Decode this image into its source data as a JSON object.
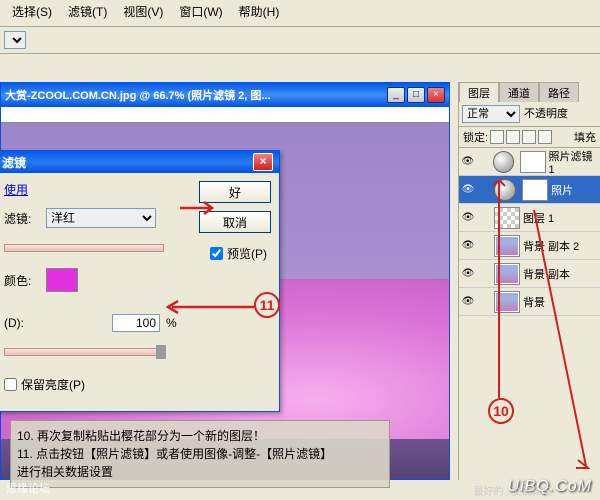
{
  "menu": {
    "select": "选择(S)",
    "filter": "滤镜(T)",
    "view": "视图(V)",
    "window": "窗口(W)",
    "help": "帮助(H)"
  },
  "document": {
    "title": "大赏-ZCOOL.COM.CN.jpg @ 66.7% (照片滤镜 2, 图..."
  },
  "dialog": {
    "title": "滤镜",
    "use_label": "使用",
    "filter_label": "滤镜:",
    "filter_value": "洋红",
    "color_label": "颜色:",
    "density_label": "(D):",
    "density_value": "100",
    "density_unit": "%",
    "preserve_label": "保留亮度(P)",
    "ok": "好",
    "cancel": "取消",
    "preview": "预览(P)"
  },
  "layers": {
    "tabs": {
      "layers": "图层",
      "channels": "通道",
      "paths": "路径"
    },
    "blend_mode": "正常",
    "opacity_label": "不透明度",
    "lock_label": "锁定:",
    "fill_label": "填充",
    "items": [
      {
        "name": "照片滤镜 1",
        "type": "adj"
      },
      {
        "name": "照片",
        "type": "adj"
      },
      {
        "name": "图层 1",
        "type": "checker"
      },
      {
        "name": "背景 副本 2",
        "type": "photo"
      },
      {
        "name": "背景 副本",
        "type": "photo"
      },
      {
        "name": "背景",
        "type": "photo"
      }
    ]
  },
  "annotation": {
    "line10": "10. 再次复制粘贴出樱花部分为一个新的图层！",
    "line11": "11. 点击按钮【照片滤镜】或者使用图像-调整-【照片滤镜】",
    "line11b": "     进行相关数据设置",
    "num10": "10",
    "num11": "11"
  },
  "watermark": "UiBQ.CoM",
  "watermark_sub": "最好的...交流论坛",
  "bottom_left": "思缘论坛"
}
